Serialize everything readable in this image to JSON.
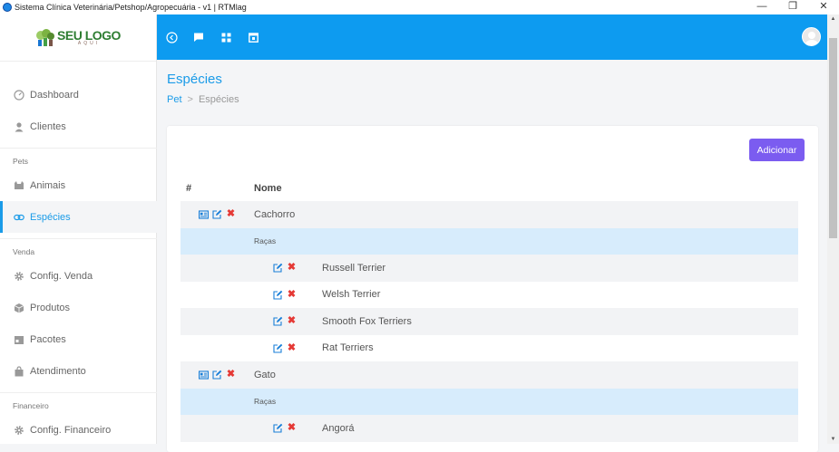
{
  "window": {
    "title": "Sistema Clínica Veterinária/Petshop/Agropecuária - v1 | RTMlag",
    "buttons": [
      "—",
      "❐",
      "✕"
    ]
  },
  "logo": {
    "main": "SEU LOGO",
    "sub": "AQUI"
  },
  "sidebar": {
    "items": [
      {
        "label": "Dashboard",
        "icon": "speedometer-icon"
      },
      {
        "label": "Clientes",
        "icon": "user-icon"
      }
    ],
    "sections": [
      {
        "title": "Pets",
        "items": [
          {
            "label": "Animais",
            "icon": "cat-icon"
          },
          {
            "label": "Espécies",
            "icon": "link-icon",
            "active": true
          }
        ]
      },
      {
        "title": "Venda",
        "items": [
          {
            "label": "Config. Venda",
            "icon": "gear-icon"
          },
          {
            "label": "Produtos",
            "icon": "box-icon"
          },
          {
            "label": "Pacotes",
            "icon": "package-icon"
          },
          {
            "label": "Atendimento",
            "icon": "bag-icon"
          }
        ]
      },
      {
        "title": "Financeiro",
        "items": [
          {
            "label": "Config. Financeiro",
            "icon": "gear-icon"
          }
        ]
      }
    ]
  },
  "topbar": {
    "icons": [
      "back-circle-icon",
      "chat-icon",
      "grid-icon",
      "calendar-icon"
    ]
  },
  "page": {
    "title": "Espécies",
    "breadcrumb": {
      "link": "Pet",
      "separator": ">",
      "current": "Espécies"
    },
    "add_button": "Adicionar"
  },
  "table": {
    "headers": {
      "hash": "#",
      "name": "Nome"
    },
    "subheader": "Raças",
    "species": [
      {
        "name": "Cachorro",
        "breeds": [
          "Russell Terrier",
          "Welsh Terrier",
          "Smooth Fox Terriers",
          "Rat Terriers"
        ]
      },
      {
        "name": "Gato",
        "breeds": [
          "Angorá"
        ]
      }
    ]
  },
  "colors": {
    "primary": "#0d9bf0",
    "accent": "#7b5cf0",
    "delete": "#e53935",
    "subheader": "#d7ecfc"
  }
}
